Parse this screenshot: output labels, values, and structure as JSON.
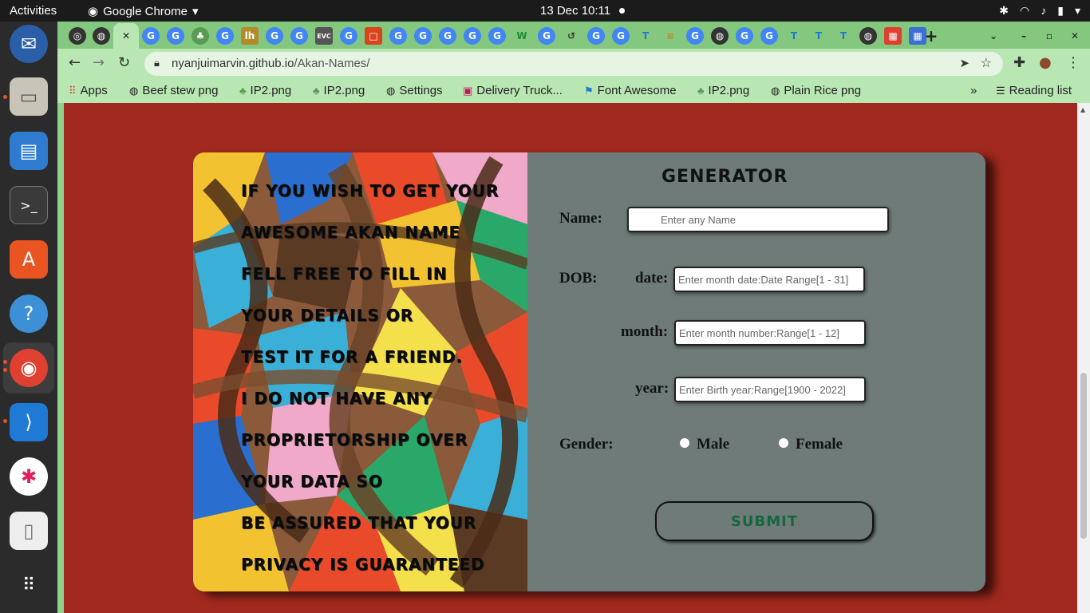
{
  "topbar": {
    "activities": "Activities",
    "app_name": "Google Chrome",
    "clock": "13 Dec  10:11"
  },
  "browser": {
    "url_host": "nyanjuimarvin.github.io",
    "url_path": "/Akan-Names/",
    "bookmarks": [
      {
        "label": "Apps",
        "icon": "apps-grid-icon"
      },
      {
        "label": "Beef stew png",
        "icon": "globe-icon"
      },
      {
        "label": "IP2.png",
        "icon": "tree-icon"
      },
      {
        "label": "IP2.png",
        "icon": "tree-icon"
      },
      {
        "label": "Settings",
        "icon": "globe-icon"
      },
      {
        "label": "Delivery Truck...",
        "icon": "brand-icon"
      },
      {
        "label": "Font Awesome",
        "icon": "flag-icon"
      },
      {
        "label": "IP2.png",
        "icon": "tree-icon"
      },
      {
        "label": "Plain Rice png",
        "icon": "globe-icon"
      }
    ],
    "reading_list": "Reading list"
  },
  "art": {
    "lines": [
      "If you wish to get your",
      "awesome akan name",
      "fell free to fill in",
      "your details or",
      "test it for a friend.",
      "I do not have any",
      "proprietorship over",
      "your data so",
      "be assured that your",
      "privacy is guaranteed"
    ]
  },
  "form": {
    "title": "Generator",
    "name_label": "Name:",
    "name_placeholder": "Enter any Name",
    "dob_label": "DOB:",
    "date_label": "date:",
    "date_placeholder": "Enter month date:Date Range[1 - 31]",
    "month_label": "month:",
    "month_placeholder": "Enter month number:Range[1 - 12]",
    "year_label": "year:",
    "year_placeholder": "Enter Birth year:Range[1900 - 2022]",
    "gender_label": "Gender:",
    "male_label": "Male",
    "female_label": "Female",
    "submit_label": "Submit"
  },
  "colors": {
    "page_bg": "#a0281e",
    "card_bg": "#6e7b79",
    "submit_text": "#16673e",
    "chrome_frame": "#84c77e"
  }
}
